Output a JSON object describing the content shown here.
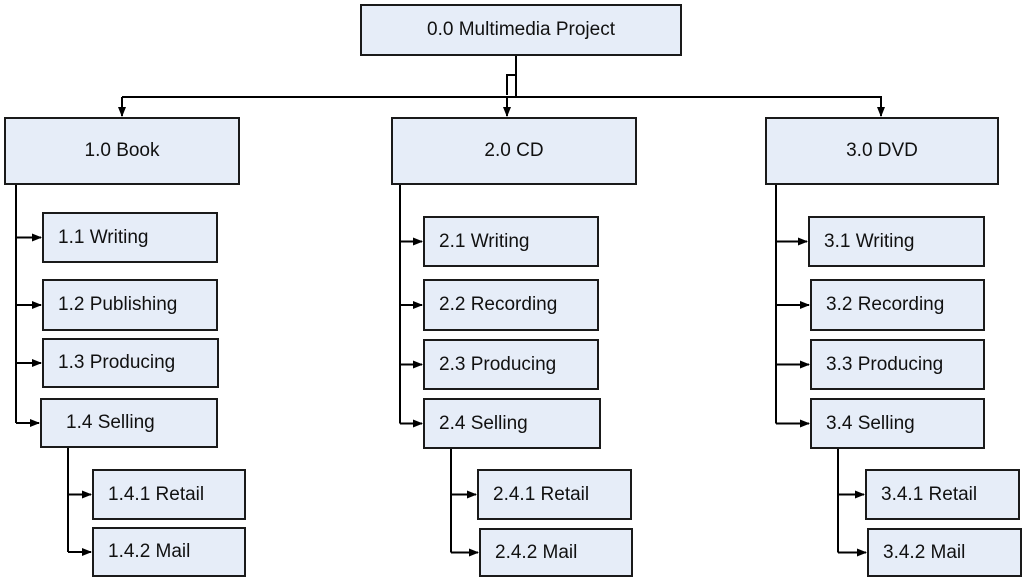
{
  "diagram": {
    "type": "work-breakdown-structure",
    "colors": {
      "box_fill": "#e6edf8",
      "box_border": "#1a1a1a",
      "connector": "#000000",
      "text": "#111111"
    },
    "root": {
      "label": "0.0 Multimedia Project",
      "children": [
        {
          "label": "1.0 Book",
          "children": [
            {
              "label": "1.1 Writing"
            },
            {
              "label": "1.2 Publishing"
            },
            {
              "label": "1.3 Producing"
            },
            {
              "label": "1.4 Selling",
              "children": [
                {
                  "label": "1.4.1 Retail"
                },
                {
                  "label": "1.4.2 Mail"
                }
              ]
            }
          ]
        },
        {
          "label": "2.0 CD",
          "children": [
            {
              "label": "2.1 Writing"
            },
            {
              "label": "2.2 Recording"
            },
            {
              "label": "2.3 Producing"
            },
            {
              "label": "2.4 Selling",
              "children": [
                {
                  "label": "2.4.1 Retail"
                },
                {
                  "label": "2.4.2 Mail"
                }
              ]
            }
          ]
        },
        {
          "label": "3.0 DVD",
          "children": [
            {
              "label": "3.1 Writing"
            },
            {
              "label": "3.2 Recording"
            },
            {
              "label": "3.3 Producing"
            },
            {
              "label": "3.4 Selling",
              "children": [
                {
                  "label": "3.4.1 Retail"
                },
                {
                  "label": "3.4.2 Mail"
                }
              ]
            }
          ]
        }
      ]
    }
  }
}
